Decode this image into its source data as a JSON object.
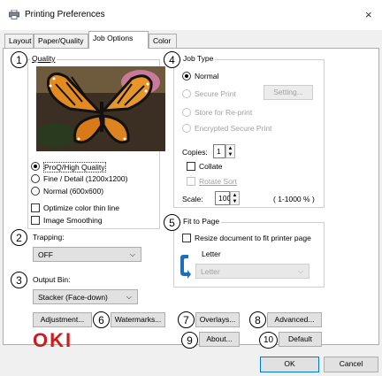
{
  "window": {
    "title": "Printing Preferences",
    "close_glyph": "×"
  },
  "tabs": [
    {
      "label": "Layout"
    },
    {
      "label": "Paper/Quality"
    },
    {
      "label": "Job Options",
      "active": true
    },
    {
      "label": "Color"
    }
  ],
  "quality": {
    "marker": "1",
    "title": "Quality",
    "options": [
      {
        "label": "ProQ/High Quality",
        "selected": true
      },
      {
        "label": "Fine / Detail (1200x1200)",
        "selected": false
      },
      {
        "label": "Normal (600x600)",
        "selected": false
      }
    ],
    "checkboxes": [
      {
        "label": "Optimize color thin line",
        "checked": false
      },
      {
        "label": "Image Smoothing",
        "checked": false
      }
    ]
  },
  "trapping": {
    "marker": "2",
    "label": "Trapping:",
    "value": "OFF"
  },
  "output_bin": {
    "marker": "3",
    "label": "Output Bin:",
    "value": "Stacker (Face-down)"
  },
  "job_type": {
    "marker": "4",
    "title": "Job Type",
    "options": [
      {
        "label": "Normal",
        "selected": true,
        "enabled": true
      },
      {
        "label": "Secure Print",
        "selected": false,
        "enabled": false
      },
      {
        "label": "Store for Re-print",
        "selected": false,
        "enabled": false
      },
      {
        "label": "Encrypted Secure Print",
        "selected": false,
        "enabled": false
      }
    ],
    "setting_button": "Setting...",
    "copies_label": "Copies:",
    "copies_value": "1",
    "collate_label": "Collate",
    "rotate_sort_label": "Rotate Sort",
    "scale_label": "Scale:",
    "scale_value": "100",
    "scale_range": "( 1-1000 % )"
  },
  "fit_to_page": {
    "marker": "5",
    "title": "Fit to Page",
    "checkbox_label": "Resize document to fit printer page",
    "paper_label": "Letter",
    "paper_select": "Letter"
  },
  "buttons": {
    "adjustment": "Adjustment...",
    "watermarks": "Watermarks...",
    "overlays": "Overlays...",
    "advanced": "Advanced...",
    "about": "About...",
    "default": "Default",
    "ok": "OK",
    "cancel": "Cancel"
  },
  "markers": {
    "watermarks": "6",
    "overlays": "7",
    "advanced": "8",
    "about": "9",
    "default": "10"
  },
  "logo": {
    "text": "OKI",
    "color": "#d11a1a"
  },
  "colors": {
    "accent": "#0078d7",
    "panel_border": "#adadad"
  }
}
